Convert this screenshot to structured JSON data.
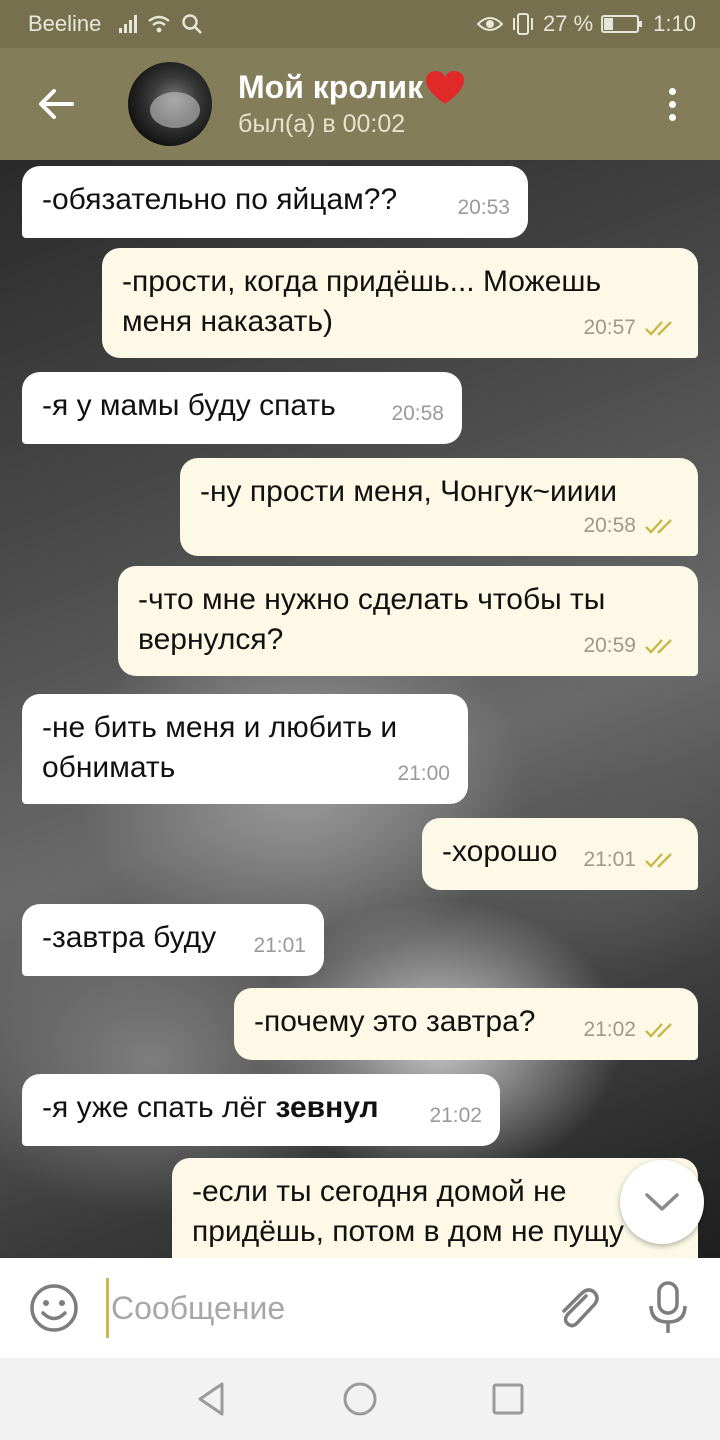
{
  "status_bar": {
    "carrier": "Beeline",
    "battery_text": "27 %",
    "battery_level": 0.27,
    "time": "1:10",
    "icons": [
      "signal-icon",
      "wifi-icon",
      "search-icon",
      "eye-icon",
      "vibrate-icon",
      "battery-icon"
    ]
  },
  "header": {
    "contact_name": "Мой кролик",
    "last_seen": "был(а) в 00:02",
    "back_icon": "arrow-left-icon",
    "menu_icon": "more-vertical-icon"
  },
  "messages": [
    {
      "dir": "in",
      "text": "-обязательно по яйцам??",
      "time": "20:53"
    },
    {
      "dir": "out",
      "text": "-прости, когда придёшь... Можешь меня наказать)",
      "time": "20:57",
      "read": true
    },
    {
      "dir": "in",
      "text": "-я у мамы буду спать",
      "time": "20:58"
    },
    {
      "dir": "out",
      "text": "-ну прости меня, Чонгук~ииии",
      "time": "20:58",
      "read": true
    },
    {
      "dir": "out",
      "text": "-что мне нужно сделать чтобы ты вернулся?",
      "time": "20:59",
      "read": true
    },
    {
      "dir": "in",
      "text": "-не бить меня и любить и обнимать",
      "time": "21:00"
    },
    {
      "dir": "out",
      "text": "-хорошо",
      "time": "21:01",
      "read": true
    },
    {
      "dir": "in",
      "text": "-завтра буду",
      "time": "21:01"
    },
    {
      "dir": "out",
      "text": "-почему это завтра?",
      "time": "21:02",
      "read": true
    },
    {
      "dir": "in",
      "text_plain": "-я уже спать лёг ",
      "text_bold": "зевнул",
      "time": "21:02"
    },
    {
      "dir": "out",
      "text": "-если ты сегодня домой не придёшь, потом в дом не пущу"
    }
  ],
  "composer": {
    "placeholder": "Сообщение",
    "emoji_icon": "smile-icon",
    "attach_icon": "paperclip-icon",
    "mic_icon": "microphone-icon"
  },
  "colors": {
    "header_bg": "#847d5a",
    "statusbar_bg": "#77704f",
    "outgoing_bubble": "#fdf9e6",
    "incoming_bubble": "#ffffff",
    "read_ticks": "#c9b84c"
  }
}
